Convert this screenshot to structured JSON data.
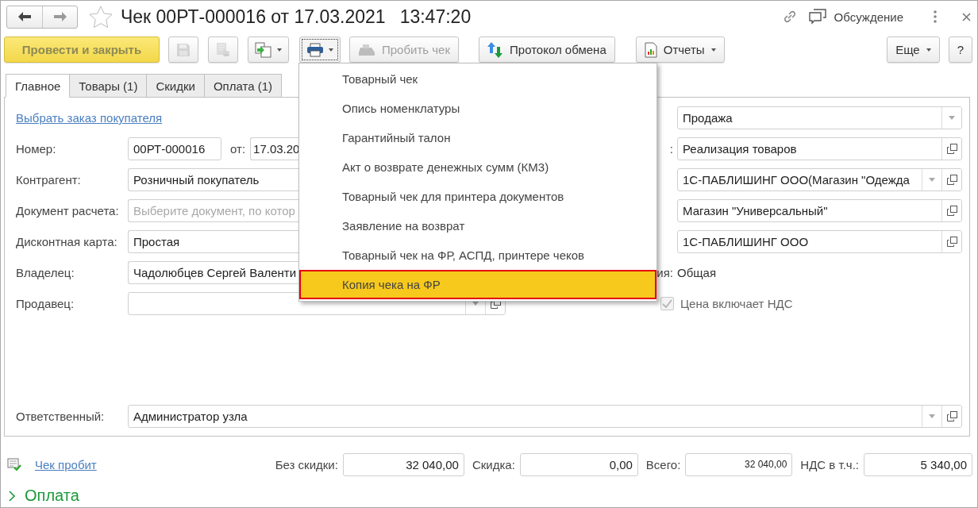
{
  "window": {
    "title": "Чек 00РТ-000016 от 17.03.2021",
    "time": "13:47:20",
    "discussion": "Обсуждение"
  },
  "toolbar": [
    {
      "kind": "primary",
      "label": "Провести и закрыть"
    },
    {
      "kind": "icon",
      "disabled": true
    },
    {
      "kind": "icon",
      "disabled": true
    },
    {
      "kind": "dropdown",
      "pressed": false
    },
    {
      "kind": "dropdown",
      "pressed": true
    },
    {
      "kind": "text",
      "label": "Пробить чек",
      "disabled": true
    },
    {
      "kind": "text",
      "label": "Протокол обмена",
      "disabled": false
    },
    {
      "kind": "text_dropdown",
      "label": "Отчеты"
    },
    {
      "kind": "text_dropdown",
      "label": "Еще"
    },
    {
      "kind": "text",
      "label": "?",
      "disabled": false
    }
  ],
  "tabs": [
    {
      "label": "Главное",
      "selected": true
    },
    {
      "label": "Товары (1)",
      "selected": false
    },
    {
      "label": "Скидки",
      "selected": false
    },
    {
      "label": "Оплата (1)",
      "selected": false
    }
  ],
  "left_rows": [
    {
      "kind": "link",
      "text": "Выбрать заказ покупателя"
    },
    {
      "kind": "number",
      "label": "Номер:",
      "value": "00РТ-000016",
      "date_label": "от:",
      "date_value": "17.03.20"
    },
    {
      "kind": "field",
      "label": "Контрагент:",
      "value": "Розничный покупатель"
    },
    {
      "kind": "field",
      "label": "Документ расчета:",
      "placeholder": "Выберите документ, по котор"
    },
    {
      "kind": "field",
      "label": "Дисконтная карта:",
      "value": "Простая"
    },
    {
      "kind": "field",
      "label": "Владелец:",
      "value": "Чадолюбцев Сергей Валенти"
    },
    {
      "kind": "select",
      "label": "Продавец:"
    }
  ],
  "right_rows": [
    {
      "kind": "select",
      "value": "Продажа"
    },
    {
      "kind": "ref",
      "label": ":",
      "value": "Реализация товаров"
    },
    {
      "kind": "select_ref",
      "value": "1С-ПАБЛИШИНГ ООО(Магазин \"Одежда"
    },
    {
      "kind": "ref",
      "value": "Магазин \"Универсальный\""
    },
    {
      "kind": "ref",
      "value": "1С-ПАБЛИШИНГ ООО"
    },
    {
      "kind": "text",
      "label": "ия:",
      "value": "Общая"
    },
    {
      "kind": "checkbox",
      "label": "Цена включает НДС",
      "checked": true,
      "disabled": true
    }
  ],
  "responsible": {
    "label": "Ответственный:",
    "value": "Администратор узла"
  },
  "print_menu": [
    {
      "label": "Товарный чек",
      "selected": false
    },
    {
      "label": "Опись номенклатуры",
      "selected": false
    },
    {
      "label": "Гарантийный талон",
      "selected": false
    },
    {
      "label": "Акт о возврате денежных сумм (КМ3)",
      "selected": false
    },
    {
      "label": "Товарный чек для принтера документов",
      "selected": false
    },
    {
      "label": "Заявление на возврат",
      "selected": false
    },
    {
      "label": "Товарный чек на ФР, АСПД, принтере чеков",
      "selected": false
    },
    {
      "label": "Копия чека на ФР",
      "selected": true
    }
  ],
  "footer": {
    "status_link": "Чек пробит",
    "totals": [
      {
        "label": "Без скидки:",
        "value": "32 040,00"
      },
      {
        "label": "Скидка:",
        "value": "0,00"
      },
      {
        "label": "Всего:",
        "value": "32 040,00"
      },
      {
        "label": "НДС в т.ч.:",
        "value": "5 340,00"
      }
    ]
  },
  "section": {
    "label": "Оплата",
    "expanded": false
  }
}
